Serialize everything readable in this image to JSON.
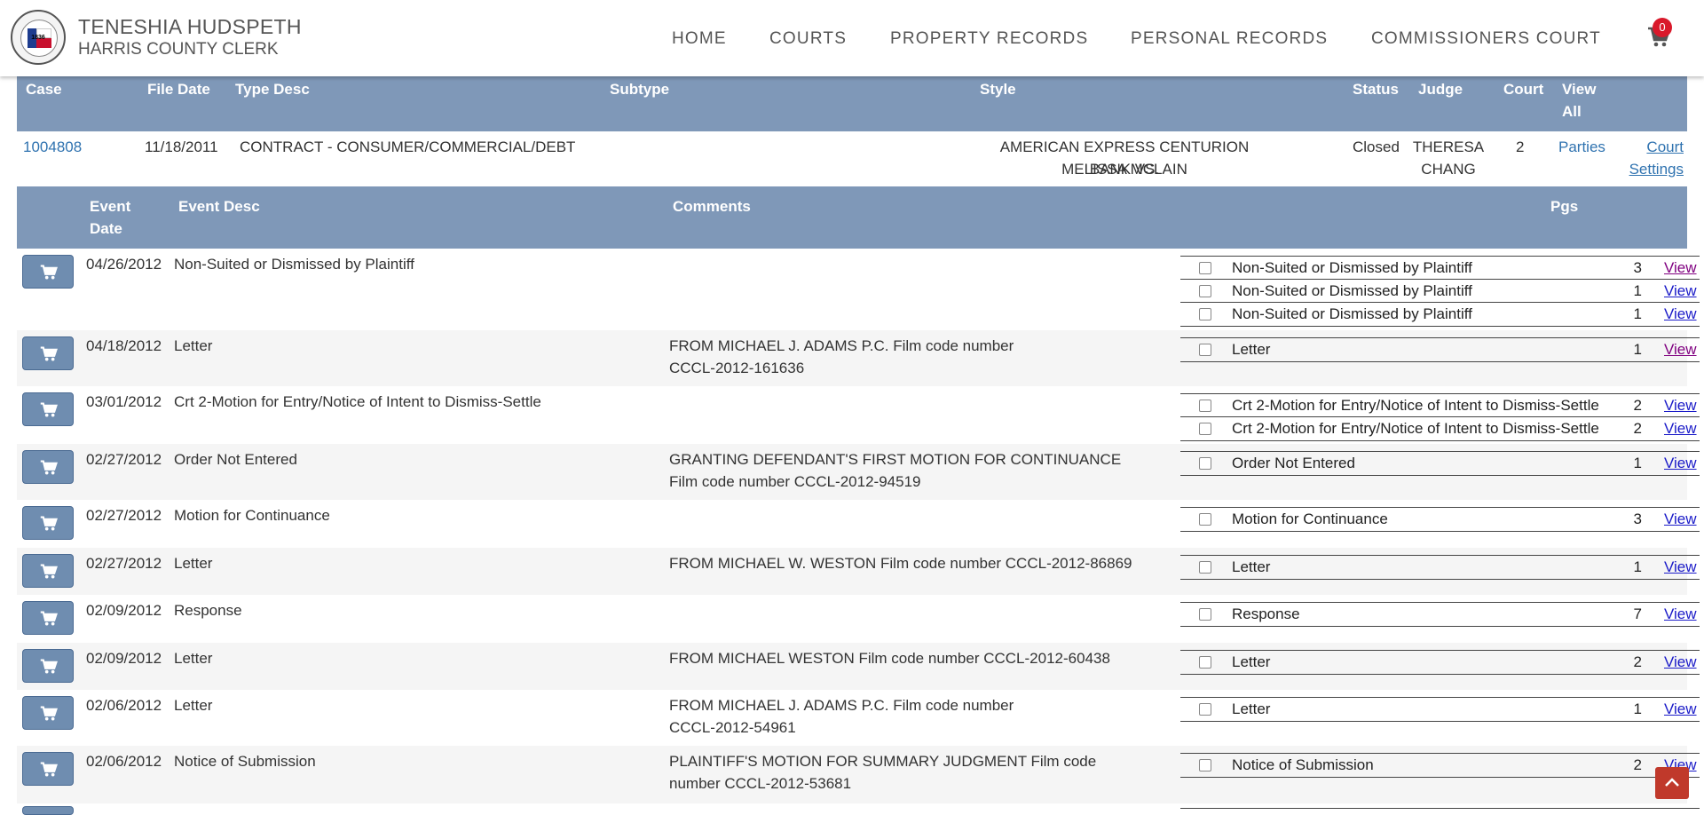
{
  "header": {
    "clerk_name": "TENESHIA HUDSPETH",
    "clerk_title": "HARRIS COUNTY CLERK",
    "seal_year": "1836",
    "nav": [
      "HOME",
      "COURTS",
      "PROPERTY RECORDS",
      "PERSONAL RECORDS",
      "COMMISSIONERS COURT"
    ],
    "cart_count": "0"
  },
  "case_table": {
    "headers": {
      "case": "Case",
      "file_date": "File Date",
      "type_desc": "Type Desc",
      "subtype": "Subtype",
      "style": "Style",
      "status": "Status",
      "judge": "Judge",
      "court": "Court",
      "view_all_1": "View",
      "view_all_2": "All"
    },
    "row": {
      "case": "1004808",
      "file_date": "11/18/2011",
      "type_desc": "CONTRACT - CONSUMER/COMMERCIAL/DEBT",
      "style_1": "AMERICAN EXPRESS CENTURION BANK VS.",
      "style_2": "MELISSA MCLAIN",
      "status": "Closed",
      "judge_1": "THERESA",
      "judge_2": "CHANG",
      "court": "2",
      "parties": "Parties",
      "settings_1": "Court",
      "settings_2": "Settings"
    }
  },
  "events_table": {
    "headers": {
      "event_date_1": "Event",
      "event_date_2": "Date",
      "event_desc": "Event Desc",
      "comments": "Comments",
      "pgs": "Pgs"
    },
    "rows": [
      {
        "date": "04/26/2012",
        "desc": "Non-Suited or Dismissed by Plaintiff",
        "comment_1": "",
        "comment_2": "",
        "docs": [
          {
            "name": "Non-Suited or Dismissed by Plaintiff",
            "pgs": "3",
            "view": "View",
            "visited": true
          },
          {
            "name": "Non-Suited or Dismissed by Plaintiff",
            "pgs": "1",
            "view": "View",
            "visited": false
          },
          {
            "name": "Non-Suited or Dismissed by Plaintiff",
            "pgs": "1",
            "view": "View",
            "visited": false
          }
        ]
      },
      {
        "date": "04/18/2012",
        "desc": "Letter",
        "comment_1": "FROM MICHAEL J. ADAMS P.C. Film code number",
        "comment_2": "CCCL-2012-161636",
        "docs": [
          {
            "name": "Letter",
            "pgs": "1",
            "view": "View",
            "visited": true
          }
        ]
      },
      {
        "date": "03/01/2012",
        "desc": "Crt 2-Motion for Entry/Notice of Intent to Dismiss-Settle",
        "comment_1": "",
        "comment_2": "",
        "docs": [
          {
            "name": "Crt 2-Motion for Entry/Notice of Intent to Dismiss-Settle",
            "pgs": "2",
            "view": "View",
            "visited": false
          },
          {
            "name": "Crt 2-Motion for Entry/Notice of Intent to Dismiss-Settle",
            "pgs": "2",
            "view": "View",
            "visited": false
          }
        ]
      },
      {
        "date": "02/27/2012",
        "desc": "Order Not Entered",
        "comment_1": "GRANTING DEFENDANT'S FIRST MOTION FOR CONTINUANCE",
        "comment_2": "Film code number CCCL-2012-94519",
        "docs": [
          {
            "name": "Order Not Entered",
            "pgs": "1",
            "view": "View",
            "visited": false
          }
        ]
      },
      {
        "date": "02/27/2012",
        "desc": "Motion for Continuance",
        "comment_1": "",
        "comment_2": "",
        "docs": [
          {
            "name": "Motion for Continuance",
            "pgs": "3",
            "view": "View",
            "visited": false
          }
        ]
      },
      {
        "date": "02/27/2012",
        "desc": "Letter",
        "comment_1": "FROM MICHAEL W. WESTON Film code number CCCL-2012-86869",
        "comment_2": "",
        "docs": [
          {
            "name": "Letter",
            "pgs": "1",
            "view": "View",
            "visited": false
          }
        ]
      },
      {
        "date": "02/09/2012",
        "desc": "Response",
        "comment_1": "",
        "comment_2": "",
        "docs": [
          {
            "name": "Response",
            "pgs": "7",
            "view": "View",
            "visited": false
          }
        ]
      },
      {
        "date": "02/09/2012",
        "desc": "Letter",
        "comment_1": "FROM MICHAEL WESTON Film code number CCCL-2012-60438",
        "comment_2": "",
        "docs": [
          {
            "name": "Letter",
            "pgs": "2",
            "view": "View",
            "visited": false
          }
        ]
      },
      {
        "date": "02/06/2012",
        "desc": "Letter",
        "comment_1": "FROM MICHAEL J. ADAMS P.C. Film code number",
        "comment_2": "CCCL-2012-54961",
        "docs": [
          {
            "name": "Letter",
            "pgs": "1",
            "view": "View",
            "visited": false
          }
        ]
      },
      {
        "date": "02/06/2012",
        "desc": "Notice of Submission",
        "comment_1": "PLAINTIFF'S MOTION FOR SUMMARY JUDGMENT Film code",
        "comment_2": "number CCCL-2012-53681",
        "docs": [
          {
            "name": "Notice of Submission",
            "pgs": "2",
            "view": "View",
            "visited": false
          }
        ]
      }
    ]
  }
}
